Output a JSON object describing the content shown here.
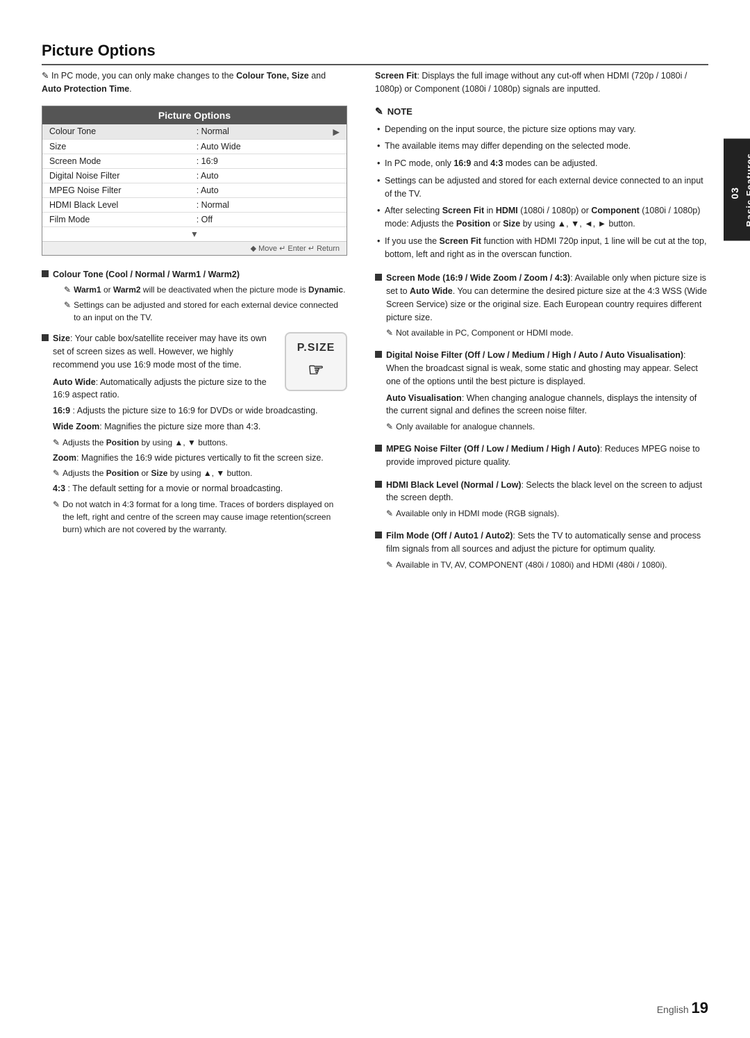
{
  "page": {
    "title": "Picture Options",
    "footer": {
      "language": "English",
      "page_number": "19"
    }
  },
  "sidebar": {
    "chapter_number": "03",
    "chapter_title": "Basic Features"
  },
  "left_col": {
    "intro": {
      "pencil": "✎",
      "text": "In PC mode, you can only make changes to the ",
      "bold_text": "Colour Tone, Size",
      "text2": " and ",
      "bold_text2": "Auto Protection Time",
      "text3": "."
    },
    "table": {
      "header": "Picture Options",
      "rows": [
        {
          "name": "Colour Tone",
          "value": ": Normal",
          "arrow": "▶",
          "highlight": true
        },
        {
          "name": "Size",
          "value": ": Auto Wide",
          "arrow": "",
          "highlight": false
        },
        {
          "name": "Screen Mode",
          "value": ": 16:9",
          "arrow": "",
          "highlight": false
        },
        {
          "name": "Digital Noise Filter",
          "value": ": Auto",
          "arrow": "",
          "highlight": false
        },
        {
          "name": "MPEG Noise Filter",
          "value": ": Auto",
          "arrow": "",
          "highlight": false
        },
        {
          "name": "HDMI Black Level",
          "value": ": Normal",
          "arrow": "",
          "highlight": false
        },
        {
          "name": "Film Mode",
          "value": ": Off",
          "arrow": "",
          "highlight": false
        }
      ],
      "footer": "◆ Move   ↵ Enter   ↵ Return"
    },
    "sections": [
      {
        "id": "colour-tone",
        "title": "Colour Tone (Cool / Normal / Warm1 / Warm2)",
        "notes": [
          {
            "pencil": "✎",
            "text": "Warm1",
            "bold": true,
            "text2": " or ",
            "text3": "Warm2",
            "bold3": true,
            "text4": " will be deactivated when the picture mode is ",
            "text5": "Dynamic",
            "bold5": true,
            "text6": "."
          },
          {
            "pencil": "✎",
            "text_plain": "Settings can be adjusted and stored for each external device connected to an input on the TV."
          }
        ]
      },
      {
        "id": "size",
        "title": "Size",
        "title_plain": ": Your cable box/satellite receiver may have its own set of screen sizes as well. However, we highly recommend you use 16:9 mode most of the time.",
        "sub_items": [
          {
            "label": "Auto Wide",
            "label_bold": true,
            "text": ": Automatically adjusts the picture size to the 16:9 aspect ratio."
          },
          {
            "label": "16:9",
            "label_bold": true,
            "text": ": Adjusts the picture size to 16:9 for DVDs or wide broadcasting."
          },
          {
            "label": "Wide Zoom",
            "label_bold": true,
            "text": ": Magnifies the picture size more than 4:3."
          },
          {
            "pencil": "✎",
            "text_plain": "Adjusts the ",
            "bold_word": "Position",
            "text_plain2": " by using ▲, ▼ buttons."
          },
          {
            "label": "Zoom",
            "label_bold": true,
            "text": ": Magnifies the 16:9 wide pictures vertically to fit the screen size."
          },
          {
            "pencil": "✎",
            "text_plain": "Adjusts the ",
            "bold_word": "Position",
            "text_plain2": " or ",
            "bold_word2": "Size",
            "text_plain3": " by using ▲, ▼ button."
          },
          {
            "label": "4:3",
            "label_bold": true,
            "text": ": The default setting for a movie or normal broadcasting."
          },
          {
            "pencil": "✎",
            "text_plain": "Do not watch in 4:3 format for a long time. Traces of borders displayed on the left, right and centre of the screen may cause image retention(screen burn) which are not covered by the warranty."
          }
        ]
      }
    ]
  },
  "right_col": {
    "screen_fit": {
      "label": "Screen Fit",
      "text": ": Displays the full image without any cut-off when HDMI (720p / 1080i / 1080p) or Component (1080i / 1080p) signals are inputted."
    },
    "note_section": {
      "header": "NOTE",
      "pencil": "✎",
      "items": [
        "Depending on the input source, the picture size options may vary.",
        "The available items may differ depending on the selected mode.",
        "In PC mode, only 16:9 and 4:3 modes can be adjusted.",
        "Settings can be adjusted and stored for each external device connected to an input of the TV.",
        "After selecting Screen Fit in HDMI (1080i / 1080p) or Component (1080i / 1080p) mode: Adjusts the Position or Size by using ▲, ▼, ◄, ► button.",
        "If you use the Screen Fit function with HDMI 720p input, 1 line will be cut at the top, bottom, left and right as in the overscan function."
      ]
    },
    "sections": [
      {
        "id": "screen-mode",
        "title": "Screen Mode (16:9 / Wide Zoom / Zoom / 4:3)",
        "text": ": Available only when picture size is set to Auto Wide. You can determine the desired picture size at the 4:3 WSS (Wide Screen Service) size or the original size. Each European country requires different picture size.",
        "note": {
          "pencil": "✎",
          "text": "Not available in PC, Component or HDMI mode."
        }
      },
      {
        "id": "digital-noise",
        "title": "Digital Noise Filter (Off / Low / Medium / High / Auto / Auto Visualisation)",
        "text": ": When the broadcast signal is weak, some static and ghosting may appear. Select one of the options until the best picture is displayed.",
        "extra": {
          "label": "Auto Visualisation",
          "label_bold": true,
          "text": ": When changing analogue channels, displays the intensity of the current signal and defines the screen noise filter."
        },
        "note": {
          "pencil": "✎",
          "text": "Only available for analogue channels."
        }
      },
      {
        "id": "mpeg-noise",
        "title": "MPEG Noise Filter (Off / Low / Medium / High / Auto)",
        "text": ": Reduces MPEG noise to provide improved picture quality."
      },
      {
        "id": "hdmi-black",
        "title": "HDMI Black Level (Normal / Low)",
        "text": ": Selects the black level on the screen to adjust the screen depth.",
        "note": {
          "pencil": "✎",
          "text": "Available only in HDMI mode (RGB signals)."
        }
      },
      {
        "id": "film-mode",
        "title": "Film Mode (Off / Auto1 / Auto2)",
        "text": ": Sets the TV to automatically sense and process film signals from all sources and adjust the picture for optimum quality.",
        "note": {
          "pencil": "✎",
          "text": "Available in TV, AV, COMPONENT (480i / 1080i) and HDMI (480i / 1080i)."
        }
      }
    ]
  }
}
